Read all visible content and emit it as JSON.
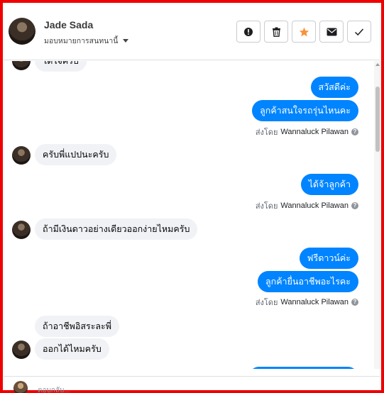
{
  "header": {
    "name": "Jade Sada",
    "assign_label": "มอบหมายการสนทนานี้",
    "actions": [
      {
        "name": "mark-spam-button",
        "icon": "alert-circle-icon"
      },
      {
        "name": "delete-button",
        "icon": "trash-icon"
      },
      {
        "name": "star-button",
        "icon": "star-icon",
        "color": "#f7923b"
      },
      {
        "name": "mark-unread-button",
        "icon": "envelope-icon"
      },
      {
        "name": "mark-done-button",
        "icon": "check-icon"
      }
    ]
  },
  "thread": {
    "partial_top_message": "ได้ใจครับ",
    "messages": [
      {
        "direction": "out",
        "text": "สวัสดีค่ะ"
      },
      {
        "direction": "out",
        "text": "ลูกค้าสนใจรถรุ่นไหนคะ"
      },
      {
        "direction": "in",
        "text": "ครับพี่แปปนะครับ"
      },
      {
        "direction": "out",
        "text": "ได้จ้าลูกค้า"
      },
      {
        "direction": "in",
        "text": "ถ้ามีเงินดาวอย่างเดียวออกง่ายไหมครับ"
      },
      {
        "direction": "out",
        "text": "ฟรีดาวน์ค่ะ"
      },
      {
        "direction": "out",
        "text": "ลูกค้ายื่นอาชีพอะไรคะ"
      },
      {
        "direction": "in",
        "text": "ถ้าอาชีพอิสระละพี่"
      },
      {
        "direction": "in",
        "text": "ออกได้ไหมครับ"
      }
    ],
    "sent_by_prefix": "ส่งโดย",
    "sent_by_name": "Wannaluck Pilawan",
    "help_glyph": "?"
  },
  "composer": {
    "placeholder": "ตอบกลับ..."
  },
  "colors": {
    "outgoing_bubble": "#0084ff",
    "incoming_bubble": "#f0f2f5",
    "frame_border": "#ee0000"
  }
}
